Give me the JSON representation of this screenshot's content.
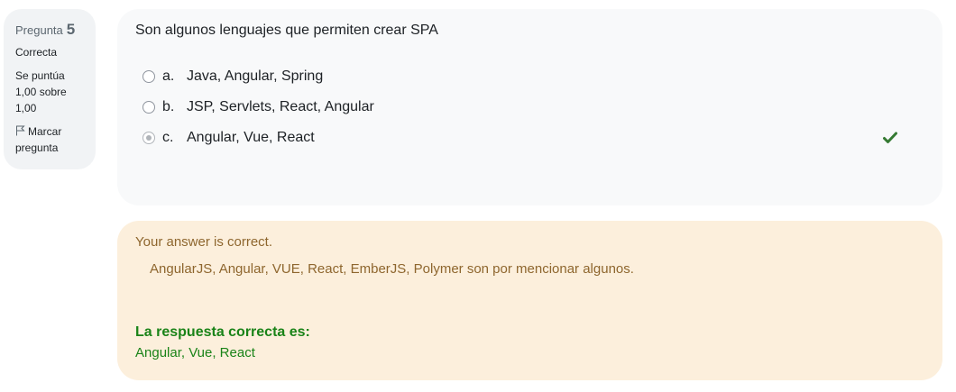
{
  "info": {
    "question_word": "Pregunta",
    "question_number": "5",
    "state": "Correcta",
    "grade_line1": "Se puntúa",
    "grade_line2": "1,00 sobre",
    "grade_line3": "1,00",
    "flag_label_line1": "Marcar",
    "flag_label_line2": "pregunta"
  },
  "question": {
    "text": "Son algunos lenguajes que permiten crear SPA",
    "answers": [
      {
        "letter": "a.",
        "text": "Java, Angular, Spring",
        "selected": false
      },
      {
        "letter": "b.",
        "text": "JSP, Servlets, React, Angular",
        "selected": false
      },
      {
        "letter": "c.",
        "text": "Angular, Vue, React",
        "selected": true,
        "correct_mark": "check-icon"
      }
    ]
  },
  "feedback": {
    "state_text": "Your answer is correct.",
    "general_text": "AngularJS, Angular, VUE, React, EmberJS, Polymer son por mencionar algunos.",
    "right_answer_title": "La respuesta correcta es:",
    "right_answer_text": "Angular, Vue, React"
  },
  "colors": {
    "info_bg": "#f1f3f5",
    "question_bg": "#f8f9fa",
    "feedback_bg": "#fcefdc",
    "feedback_text": "#8e662e",
    "correct_green": "#1a8318",
    "check_green": "#357a32"
  }
}
